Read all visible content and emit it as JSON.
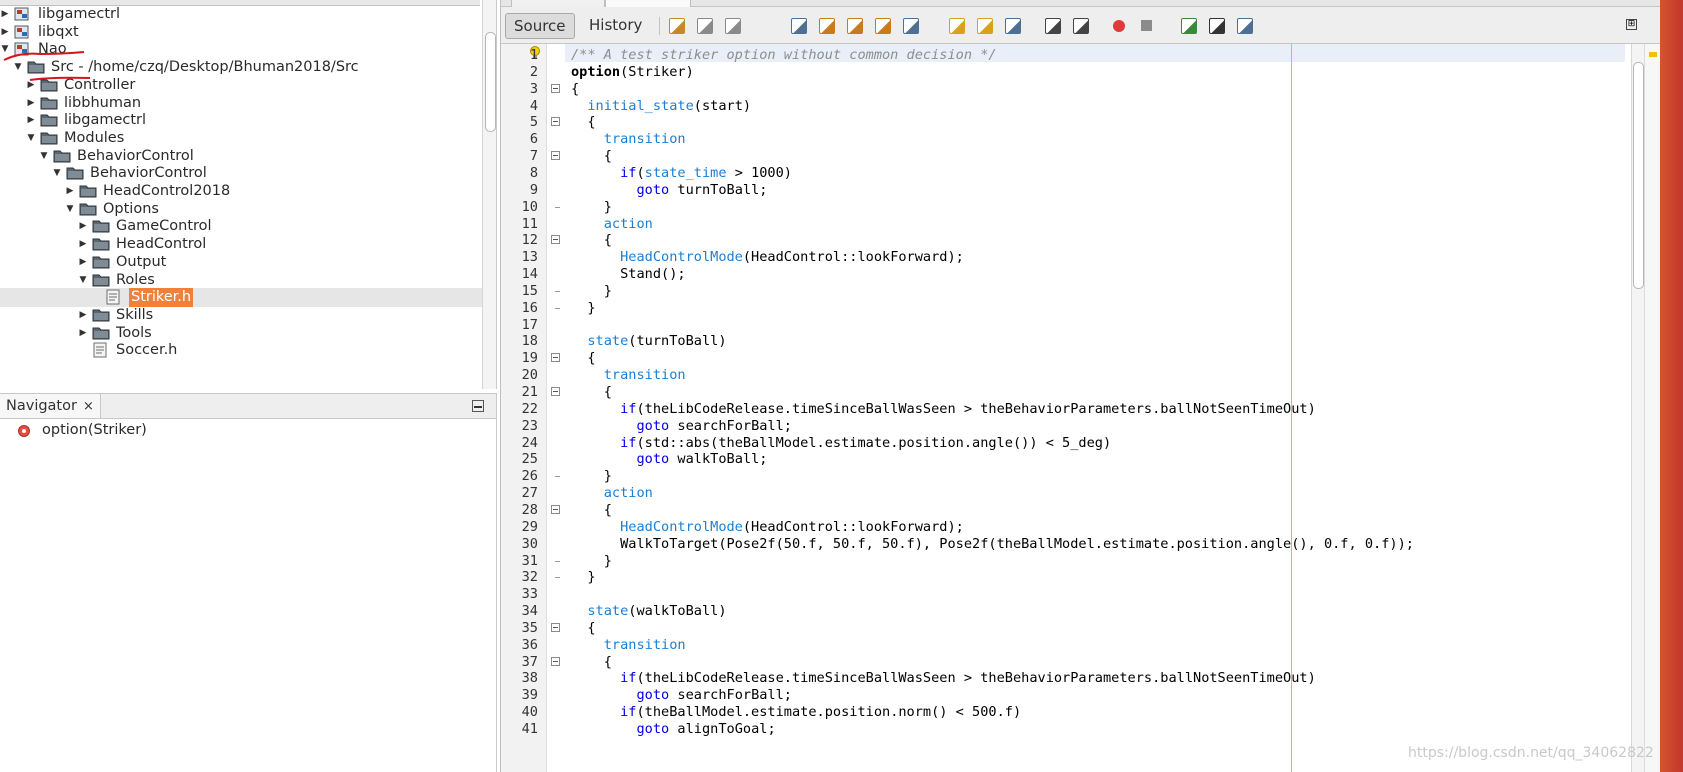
{
  "tree": {
    "rows": [
      {
        "label": "libgamectrl",
        "kind": "lib",
        "indent": 0,
        "twisty": "right"
      },
      {
        "label": "libqxt",
        "kind": "lib",
        "indent": 0,
        "twisty": "right"
      },
      {
        "label": "Nao",
        "kind": "lib",
        "indent": 0,
        "twisty": "down"
      },
      {
        "label": "Src - /home/czq/Desktop/Bhuman2018/Src",
        "kind": "folder",
        "indent": 1,
        "twisty": "down"
      },
      {
        "label": "Controller",
        "kind": "folder",
        "indent": 2,
        "twisty": "right"
      },
      {
        "label": "libbhuman",
        "kind": "folder",
        "indent": 2,
        "twisty": "right"
      },
      {
        "label": "libgamectrl",
        "kind": "folder",
        "indent": 2,
        "twisty": "right"
      },
      {
        "label": "Modules",
        "kind": "folder",
        "indent": 2,
        "twisty": "down"
      },
      {
        "label": "BehaviorControl",
        "kind": "folder",
        "indent": 3,
        "twisty": "down"
      },
      {
        "label": "BehaviorControl",
        "kind": "folder",
        "indent": 4,
        "twisty": "down"
      },
      {
        "label": "HeadControl2018",
        "kind": "folder",
        "indent": 5,
        "twisty": "right"
      },
      {
        "label": "Options",
        "kind": "folder",
        "indent": 5,
        "twisty": "down"
      },
      {
        "label": "GameControl",
        "kind": "folder",
        "indent": 6,
        "twisty": "right"
      },
      {
        "label": "HeadControl",
        "kind": "folder",
        "indent": 6,
        "twisty": "right"
      },
      {
        "label": "Output",
        "kind": "folder",
        "indent": 6,
        "twisty": "right"
      },
      {
        "label": "Roles",
        "kind": "folder",
        "indent": 6,
        "twisty": "down"
      },
      {
        "label": "Striker.h",
        "kind": "file",
        "indent": 7,
        "twisty": "none",
        "selected": true
      },
      {
        "label": "Skills",
        "kind": "folder",
        "indent": 6,
        "twisty": "right"
      },
      {
        "label": "Tools",
        "kind": "folder",
        "indent": 6,
        "twisty": "right"
      },
      {
        "label": "Soccer.h",
        "kind": "file",
        "indent": 6,
        "twisty": "none"
      }
    ]
  },
  "navigator": {
    "tab_label": "Navigator",
    "close_glyph": "×",
    "item_label": "option(Striker)"
  },
  "toolbar": {
    "source_label": "Source",
    "history_label": "History",
    "expand_glyph": "⊞"
  },
  "editor": {
    "line_numbers": [
      "1",
      "2",
      "3",
      "4",
      "5",
      "6",
      "7",
      "8",
      "9",
      "10",
      "11",
      "12",
      "13",
      "14",
      "15",
      "16",
      "17",
      "18",
      "19",
      "20",
      "21",
      "22",
      "23",
      "24",
      "25",
      "26",
      "27",
      "28",
      "29",
      "30",
      "31",
      "32",
      "33",
      "34",
      "35",
      "36",
      "37",
      "38",
      "39",
      "40",
      "41"
    ],
    "lines": [
      [
        {
          "t": "/** A test striker option without common decision */",
          "c": "comment"
        }
      ],
      [
        {
          "t": "option",
          "c": "bold"
        },
        {
          "t": "(Striker)",
          "c": ""
        }
      ],
      [
        {
          "t": "{",
          "c": ""
        }
      ],
      [
        {
          "t": "  ",
          "c": ""
        },
        {
          "t": "initial_state",
          "c": "id"
        },
        {
          "t": "(start)",
          "c": ""
        }
      ],
      [
        {
          "t": "  {",
          "c": ""
        }
      ],
      [
        {
          "t": "    ",
          "c": ""
        },
        {
          "t": "transition",
          "c": "id"
        }
      ],
      [
        {
          "t": "    {",
          "c": ""
        }
      ],
      [
        {
          "t": "      ",
          "c": ""
        },
        {
          "t": "if",
          "c": "kw"
        },
        {
          "t": "(",
          "c": ""
        },
        {
          "t": "state_time",
          "c": "id"
        },
        {
          "t": " > 1000)",
          "c": ""
        }
      ],
      [
        {
          "t": "        ",
          "c": ""
        },
        {
          "t": "goto",
          "c": "kw"
        },
        {
          "t": " turnToBall;",
          "c": ""
        }
      ],
      [
        {
          "t": "    }",
          "c": ""
        }
      ],
      [
        {
          "t": "    ",
          "c": ""
        },
        {
          "t": "action",
          "c": "id"
        }
      ],
      [
        {
          "t": "    {",
          "c": ""
        }
      ],
      [
        {
          "t": "      ",
          "c": ""
        },
        {
          "t": "HeadControlMode",
          "c": "id"
        },
        {
          "t": "(HeadControl::lookForward);",
          "c": ""
        }
      ],
      [
        {
          "t": "      Stand();",
          "c": ""
        }
      ],
      [
        {
          "t": "    }",
          "c": ""
        }
      ],
      [
        {
          "t": "  }",
          "c": ""
        }
      ],
      [
        {
          "t": "",
          "c": ""
        }
      ],
      [
        {
          "t": "  ",
          "c": ""
        },
        {
          "t": "state",
          "c": "id"
        },
        {
          "t": "(turnToBall)",
          "c": ""
        }
      ],
      [
        {
          "t": "  {",
          "c": ""
        }
      ],
      [
        {
          "t": "    ",
          "c": ""
        },
        {
          "t": "transition",
          "c": "id"
        }
      ],
      [
        {
          "t": "    {",
          "c": ""
        }
      ],
      [
        {
          "t": "      ",
          "c": ""
        },
        {
          "t": "if",
          "c": "kw"
        },
        {
          "t": "(theLibCodeRelease.timeSinceBallWasSeen > theBehaviorParameters.ballNotSeenTimeOut)",
          "c": ""
        }
      ],
      [
        {
          "t": "        ",
          "c": ""
        },
        {
          "t": "goto",
          "c": "kw"
        },
        {
          "t": " searchForBall;",
          "c": ""
        }
      ],
      [
        {
          "t": "      ",
          "c": ""
        },
        {
          "t": "if",
          "c": "kw"
        },
        {
          "t": "(std::abs(theBallModel.estimate.position.angle()) < 5_deg)",
          "c": ""
        }
      ],
      [
        {
          "t": "        ",
          "c": ""
        },
        {
          "t": "goto",
          "c": "kw"
        },
        {
          "t": " walkToBall;",
          "c": ""
        }
      ],
      [
        {
          "t": "    }",
          "c": ""
        }
      ],
      [
        {
          "t": "    ",
          "c": ""
        },
        {
          "t": "action",
          "c": "id"
        }
      ],
      [
        {
          "t": "    {",
          "c": ""
        }
      ],
      [
        {
          "t": "      ",
          "c": ""
        },
        {
          "t": "HeadControlMode",
          "c": "id"
        },
        {
          "t": "(HeadControl::lookForward);",
          "c": ""
        }
      ],
      [
        {
          "t": "      WalkToTarget(Pose2f(50.f, 50.f, 50.f), Pose2f(theBallModel.estimate.position.angle(), 0.f, 0.f));",
          "c": ""
        }
      ],
      [
        {
          "t": "    }",
          "c": ""
        }
      ],
      [
        {
          "t": "  }",
          "c": ""
        }
      ],
      [
        {
          "t": "",
          "c": ""
        }
      ],
      [
        {
          "t": "  ",
          "c": ""
        },
        {
          "t": "state",
          "c": "id"
        },
        {
          "t": "(walkToBall)",
          "c": ""
        }
      ],
      [
        {
          "t": "  {",
          "c": ""
        }
      ],
      [
        {
          "t": "    ",
          "c": ""
        },
        {
          "t": "transition",
          "c": "id"
        }
      ],
      [
        {
          "t": "    {",
          "c": ""
        }
      ],
      [
        {
          "t": "      ",
          "c": ""
        },
        {
          "t": "if",
          "c": "kw"
        },
        {
          "t": "(theLibCodeRelease.timeSinceBallWasSeen > theBehaviorParameters.ballNotSeenTimeOut)",
          "c": ""
        }
      ],
      [
        {
          "t": "        ",
          "c": ""
        },
        {
          "t": "goto",
          "c": "kw"
        },
        {
          "t": " searchForBall;",
          "c": ""
        }
      ],
      [
        {
          "t": "      ",
          "c": ""
        },
        {
          "t": "if",
          "c": "kw"
        },
        {
          "t": "(theBallModel.estimate.position.norm() < 500.f)",
          "c": ""
        }
      ],
      [
        {
          "t": "        ",
          "c": ""
        },
        {
          "t": "goto",
          "c": "kw"
        },
        {
          "t": " alignToGoal;",
          "c": ""
        }
      ]
    ],
    "fold_open_lines": [
      3,
      5,
      7,
      12,
      19,
      21,
      28,
      35,
      37
    ],
    "fold_close_lines": [
      10,
      15,
      16,
      26,
      31,
      32
    ]
  },
  "watermark": "https://blog.csdn.net/qq_34062822",
  "colors": {
    "accent_selection": "#f0813a",
    "keyword": "#0000e6",
    "identifier": "#1a7fd4",
    "comment": "#8d8d8d",
    "annotation_red": "#d8141c"
  }
}
